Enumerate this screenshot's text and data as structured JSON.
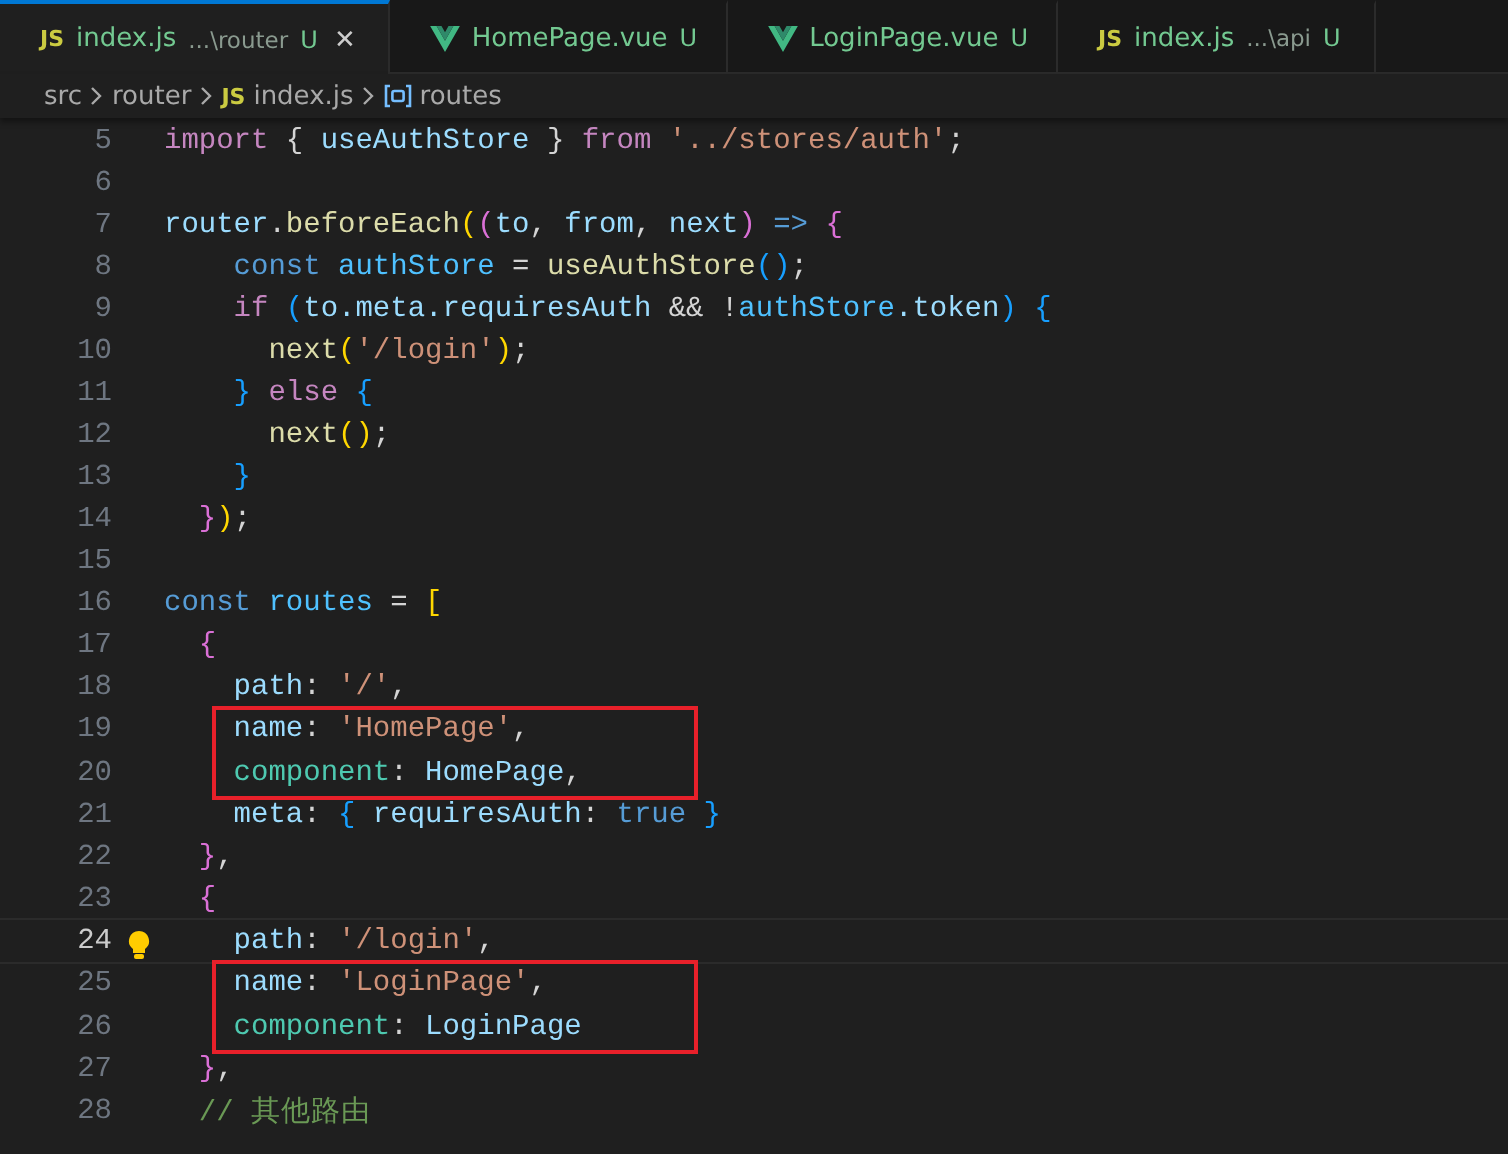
{
  "tabs": [
    {
      "kind": "js",
      "badge": "JS",
      "name": "index.js",
      "description": "...\\router",
      "status": "U",
      "selected": true,
      "close": "✕"
    },
    {
      "kind": "vue",
      "name": "HomePage.vue",
      "status": "U",
      "selected": false
    },
    {
      "kind": "vue",
      "name": "LoginPage.vue",
      "status": "U",
      "selected": false
    },
    {
      "kind": "js",
      "badge": "JS",
      "name": "index.js",
      "description": "...\\api",
      "status": "U",
      "selected": false
    }
  ],
  "breadcrumbs": [
    {
      "kind": "folder",
      "label": "src"
    },
    {
      "kind": "folder",
      "label": "router"
    },
    {
      "kind": "file",
      "badge": "JS",
      "label": "index.js"
    },
    {
      "kind": "symbol",
      "label": "routes"
    }
  ],
  "editor": {
    "lines": [
      {
        "kind": "line",
        "number": "5",
        "current": false,
        "tokens": [
          {
            "text": "import",
            "color": "#c586c0"
          },
          {
            "text": " { ",
            "color": "#d4d4d4"
          },
          {
            "text": "useAuthStore",
            "color": "#9cdcfe"
          },
          {
            "text": " } ",
            "color": "#d4d4d4"
          },
          {
            "text": "from ",
            "color": "#c586c0"
          },
          {
            "text": "'../stores/auth'",
            "color": "#ce9178"
          },
          {
            "text": ";",
            "color": "#d4d4d4"
          }
        ]
      },
      {
        "kind": "line",
        "number": "6",
        "current": false
      },
      {
        "kind": "line",
        "number": "7",
        "current": false,
        "tokens": [
          {
            "text": "router",
            "color": "#9cdcfe"
          },
          {
            "text": ".",
            "color": "#d4d4d4"
          },
          {
            "text": "beforeEach",
            "color": "#dcdcaa"
          },
          {
            "text": "(",
            "color": "#ffd700"
          },
          {
            "text": "(",
            "color": "#da70d6"
          },
          {
            "text": "to",
            "color": "#9cdcfe"
          },
          {
            "text": ", ",
            "color": "#d4d4d4"
          },
          {
            "text": "from",
            "color": "#9cdcfe"
          },
          {
            "text": ", ",
            "color": "#d4d4d4"
          },
          {
            "text": "next",
            "color": "#9cdcfe"
          },
          {
            "text": ")",
            "color": "#da70d6"
          },
          {
            "text": " => ",
            "color": "#569cd6"
          },
          {
            "text": "{",
            "color": "#da70d6"
          }
        ]
      },
      {
        "kind": "line",
        "number": "8",
        "current": false,
        "tokens": [
          {
            "text": "    const",
            "color": "#569cd6"
          },
          {
            "text": " authStore",
            "color": "#4fc1ff"
          },
          {
            "text": " = ",
            "color": "#d4d4d4"
          },
          {
            "text": "useAuthStore",
            "color": "#dcdcaa"
          },
          {
            "text": "()",
            "color": "#179fff"
          },
          {
            "text": ";",
            "color": "#d4d4d4"
          }
        ]
      },
      {
        "kind": "line",
        "number": "9",
        "current": false,
        "tokens": [
          {
            "text": "    if ",
            "color": "#c586c0"
          },
          {
            "text": "(",
            "color": "#179fff"
          },
          {
            "text": "to.meta.requiresAuth",
            "color": "#9cdcfe"
          },
          {
            "text": " && !",
            "color": "#d4d4d4"
          },
          {
            "text": "authStore",
            "color": "#4fc1ff"
          },
          {
            "text": ".token",
            "color": "#9cdcfe"
          },
          {
            "text": ")",
            "color": "#179fff"
          },
          {
            "text": " {",
            "color": "#179fff"
          }
        ]
      },
      {
        "kind": "line",
        "number": "10",
        "current": false,
        "tokens": [
          {
            "text": "      next",
            "color": "#dcdcaa"
          },
          {
            "text": "(",
            "color": "#ffd700"
          },
          {
            "text": "'/login'",
            "color": "#ce9178"
          },
          {
            "text": ")",
            "color": "#ffd700"
          },
          {
            "text": ";",
            "color": "#d4d4d4"
          }
        ]
      },
      {
        "kind": "line",
        "number": "11",
        "current": false,
        "tokens": [
          {
            "text": "    }",
            "color": "#179fff"
          },
          {
            "text": " else ",
            "color": "#c586c0"
          },
          {
            "text": "{",
            "color": "#179fff"
          }
        ]
      },
      {
        "kind": "line",
        "number": "12",
        "current": false,
        "tokens": [
          {
            "text": "      next",
            "color": "#dcdcaa"
          },
          {
            "text": "()",
            "color": "#ffd700"
          },
          {
            "text": ";",
            "color": "#d4d4d4"
          }
        ]
      },
      {
        "kind": "line",
        "number": "13",
        "current": false,
        "tokens": [
          {
            "text": "    }",
            "color": "#179fff"
          }
        ]
      },
      {
        "kind": "line",
        "number": "14",
        "current": false,
        "tokens": [
          {
            "text": "  }",
            "color": "#da70d6"
          },
          {
            "text": ")",
            "color": "#ffd700"
          },
          {
            "text": ";",
            "color": "#d4d4d4"
          }
        ]
      },
      {
        "kind": "line",
        "number": "15",
        "current": false
      },
      {
        "kind": "line",
        "number": "16",
        "current": false,
        "tokens": [
          {
            "text": "const",
            "color": "#569cd6"
          },
          {
            "text": " routes",
            "color": "#4fc1ff"
          },
          {
            "text": " = ",
            "color": "#d4d4d4"
          },
          {
            "text": "[",
            "color": "#ffd700"
          }
        ]
      },
      {
        "kind": "line",
        "number": "17",
        "current": false,
        "tokens": [
          {
            "text": "  {",
            "color": "#da70d6"
          }
        ]
      },
      {
        "kind": "line",
        "number": "18",
        "current": false,
        "tokens": [
          {
            "text": "    path",
            "color": "#9cdcfe"
          },
          {
            "text": ": ",
            "color": "#d4d4d4"
          },
          {
            "text": "'/'",
            "color": "#ce9178"
          },
          {
            "text": ",",
            "color": "#d4d4d4"
          }
        ]
      },
      {
        "kind": "boxed",
        "lines": [
          {
            "number": "19",
            "current": false,
            "tokens": [
              {
                "text": "    name",
                "color": "#9cdcfe"
              },
              {
                "text": ": ",
                "color": "#d4d4d4"
              },
              {
                "text": "'HomePage'",
                "color": "#ce9178"
              },
              {
                "text": ",",
                "color": "#d4d4d4"
              }
            ]
          },
          {
            "number": "20",
            "current": false,
            "tokens": [
              {
                "text": "    component",
                "color": "#4ec9b0"
              },
              {
                "text": ": ",
                "color": "#d4d4d4"
              },
              {
                "text": "HomePage",
                "color": "#9cdcfe"
              },
              {
                "text": ",",
                "color": "#d4d4d4"
              }
            ]
          }
        ]
      },
      {
        "kind": "line",
        "number": "21",
        "current": false,
        "tokens": [
          {
            "text": "    meta",
            "color": "#9cdcfe"
          },
          {
            "text": ": ",
            "color": "#d4d4d4"
          },
          {
            "text": "{",
            "color": "#179fff"
          },
          {
            "text": " requiresAuth",
            "color": "#9cdcfe"
          },
          {
            "text": ": ",
            "color": "#d4d4d4"
          },
          {
            "text": "true",
            "color": "#569cd6"
          },
          {
            "text": " }",
            "color": "#179fff"
          }
        ]
      },
      {
        "kind": "line",
        "number": "22",
        "current": false,
        "tokens": [
          {
            "text": "  }",
            "color": "#da70d6"
          },
          {
            "text": ",",
            "color": "#d4d4d4"
          }
        ]
      },
      {
        "kind": "line",
        "number": "23",
        "current": false,
        "tokens": [
          {
            "text": "  {",
            "color": "#da70d6"
          }
        ]
      },
      {
        "kind": "line",
        "number": "24",
        "current": true,
        "tokens": [
          {
            "text": "    path",
            "color": "#9cdcfe"
          },
          {
            "text": ": ",
            "color": "#d4d4d4"
          },
          {
            "text": "'/login'",
            "color": "#ce9178"
          },
          {
            "text": ",",
            "color": "#d4d4d4"
          }
        ]
      },
      {
        "kind": "boxed",
        "lines": [
          {
            "number": "25",
            "current": false,
            "tokens": [
              {
                "text": "    name",
                "color": "#9cdcfe"
              },
              {
                "text": ": ",
                "color": "#d4d4d4"
              },
              {
                "text": "'LoginPage'",
                "color": "#ce9178"
              },
              {
                "text": ",",
                "color": "#d4d4d4"
              }
            ]
          },
          {
            "number": "26",
            "current": false,
            "tokens": [
              {
                "text": "    component",
                "color": "#4ec9b0"
              },
              {
                "text": ": ",
                "color": "#d4d4d4"
              },
              {
                "text": "LoginPage",
                "color": "#9cdcfe"
              }
            ]
          }
        ]
      },
      {
        "kind": "line",
        "number": "27",
        "current": false,
        "tokens": [
          {
            "text": "  }",
            "color": "#da70d6"
          },
          {
            "text": ",",
            "color": "#d4d4d4"
          }
        ]
      },
      {
        "kind": "line",
        "number": "28",
        "current": false,
        "tokens": [
          {
            "text": "  // 其他路由",
            "color": "#6a9955"
          }
        ]
      }
    ]
  }
}
